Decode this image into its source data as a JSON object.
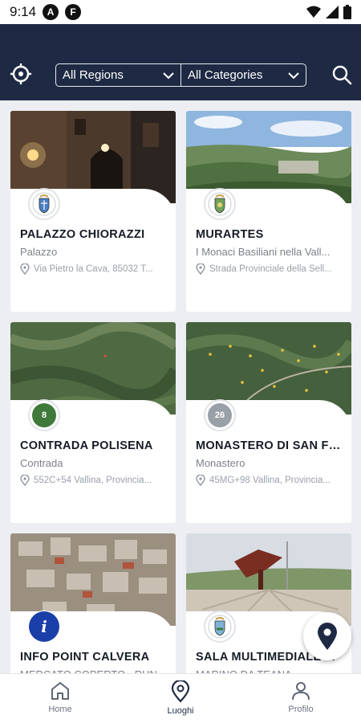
{
  "status_bar": {
    "time": "9:14",
    "app_icon_1": "A",
    "app_icon_2": "F"
  },
  "header": {
    "locate_icon": "crosshair-icon",
    "filters": [
      {
        "label": "All Regions"
      },
      {
        "label": "All Categories"
      }
    ],
    "search_icon": "search-icon"
  },
  "cards": [
    {
      "title": "PALAZZO CHIORAZZI",
      "category": "Palazzo",
      "address": "Via Pietro la Cava, 85032 T...",
      "badge": "crest"
    },
    {
      "title": "MURARTES",
      "category": "I Monaci Basiliani nella Vall...",
      "address": "Strada Provinciale della Sell...",
      "badge": "crest"
    },
    {
      "title": "CONTRADA POLISENA",
      "category": "Contrada",
      "address": "552C+54 Vallina, Provincia...",
      "badge": "8"
    },
    {
      "title": "MONASTERO DI SAN FIL...",
      "category": "Monastero",
      "address": "45MG+98 Vallina, Provincia...",
      "badge": "26"
    },
    {
      "title": "INFO POINT CALVERA",
      "category": "MERCATO COPERTO - RUN...",
      "address": "",
      "badge": "i"
    },
    {
      "title": "SALA MULTIMEDIALE ...",
      "category": "MARINO DA TEANA",
      "address": "",
      "badge": "crest"
    }
  ],
  "bottom_nav": [
    {
      "label": "Home",
      "icon": "home-icon"
    },
    {
      "label": "Luoghi",
      "icon": "map-pin-icon"
    },
    {
      "label": "Profilo",
      "icon": "user-icon"
    }
  ],
  "colors": {
    "header": "#1e2a44",
    "accent": "#1e2a44",
    "info_badge": "#1b3fa8"
  }
}
